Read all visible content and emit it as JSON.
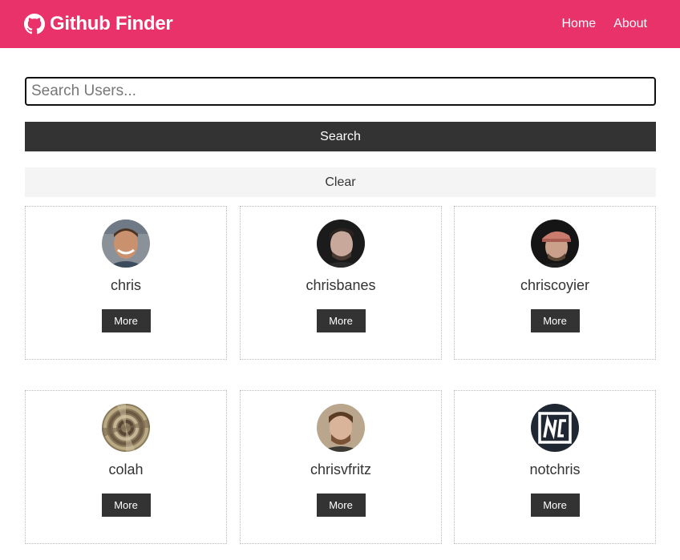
{
  "navbar": {
    "brand_icon": "github-icon",
    "title": "Github Finder",
    "links": [
      {
        "label": "Home"
      },
      {
        "label": "About"
      }
    ],
    "background": "#e9326a"
  },
  "search": {
    "placeholder": "Search Users...",
    "value": "",
    "search_label": "Search",
    "clear_label": "Clear"
  },
  "users": [
    {
      "login": "chris",
      "more_label": "More"
    },
    {
      "login": "chrisbanes",
      "more_label": "More"
    },
    {
      "login": "chriscoyier",
      "more_label": "More"
    },
    {
      "login": "colah",
      "more_label": "More"
    },
    {
      "login": "chrisvfritz",
      "more_label": "More"
    },
    {
      "login": "notchris",
      "more_label": "More"
    }
  ]
}
